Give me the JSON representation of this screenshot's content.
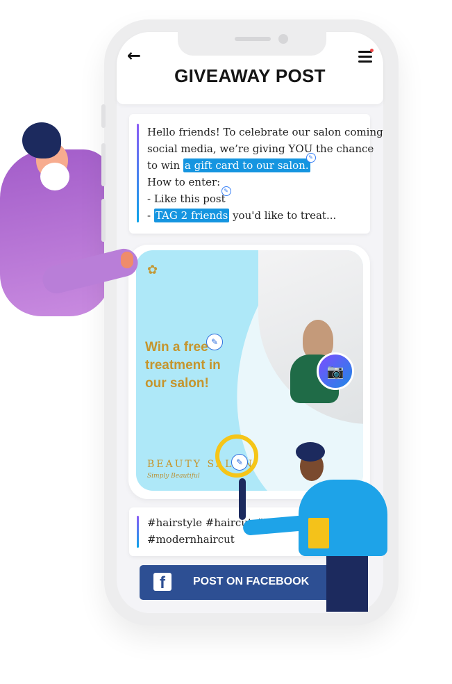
{
  "header": {
    "title": "GIVEAWAY POST",
    "back_icon": "arrow-left-icon",
    "menu_icon": "hamburger-menu-icon"
  },
  "caption": {
    "line1": "Hello friends! To celebrate our salon coming",
    "line2": "social media, we’re giving YOU the chance",
    "line3_prefix": "to win",
    "line3_highlight": "a gift card to our salon.",
    "line4": "How to enter:",
    "line5": "- Like this post",
    "line6_prefix": "-",
    "line6_highlight": "TAG 2 friends",
    "line6_suffix": "you'd like to treat..."
  },
  "ad": {
    "headline": "Win a free treatment in our salon!",
    "brand": "BEAUTY SALON",
    "tagline": "Simply Beautiful",
    "accent_color": "#c5952d",
    "background_color": "#aee8f8"
  },
  "hashtags": {
    "line1": "#hairstyle   #haircut   #longh",
    "line2": "#modernhaircut"
  },
  "facebook_button": {
    "label": "POST ON FACEBOOK",
    "icon_letter": "f",
    "color": "#2d4f93"
  }
}
